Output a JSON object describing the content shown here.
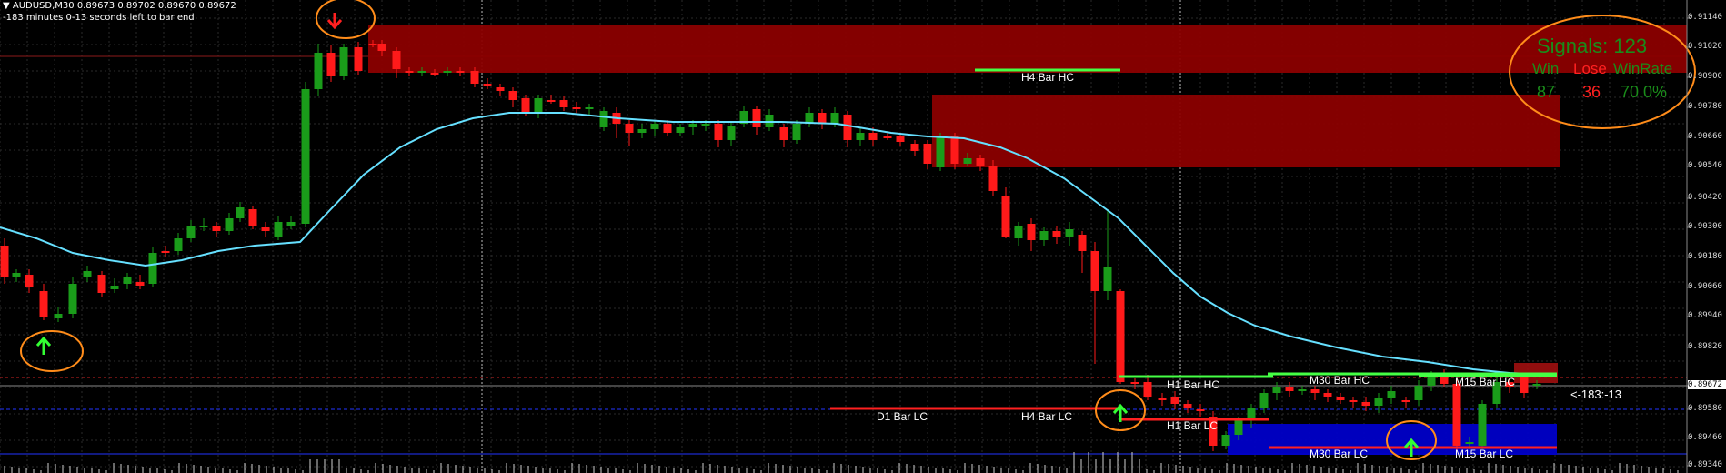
{
  "header": {
    "symbol_line": "AUDUSD,M30  0.89673 0.89702 0.89670 0.89672",
    "countdown_line": "-183 minutes 0-13 seconds left to bar end"
  },
  "price_axis": {
    "labels": [
      "0.91140",
      "0.91020",
      "0.90900",
      "0.90780",
      "0.90660",
      "0.90540",
      "0.90420",
      "0.90300",
      "0.90180",
      "0.90060",
      "0.89940",
      "0.89820",
      "0.89672",
      "0.89580",
      "0.89460",
      "0.89340"
    ],
    "current_price": "0.89672"
  },
  "signals_panel": {
    "title": "Signals: 123",
    "win_label": "Win",
    "lose_label": "Lose",
    "winrate_label": "WinRate",
    "win_value": "87",
    "lose_value": "36",
    "winrate_value": "70.0%"
  },
  "level_labels": {
    "h4_bar_hc": "H4 Bar HC",
    "h1_bar_hc": "H1 Bar HC",
    "m30_bar_hc": "M30 Bar HC",
    "m15_bar_hc": "M15 Bar HC",
    "d1_bar_lc": "D1 Bar LC",
    "h4_bar_lc": "H4 Bar LC",
    "h1_bar_lc": "H1 Bar LC",
    "m30_bar_lc": "M30 Bar LC",
    "m15_bar_lc": "M15 Bar LC",
    "countdown_tag": "<-183:-13"
  },
  "colors": {
    "bull": "#1a9c1a",
    "bear": "#ff1a1a",
    "ma": "#66e0ff",
    "zone_red": "#8b0000",
    "zone_blue": "#0000c8",
    "signal_circle": "#ff8c1a"
  }
}
